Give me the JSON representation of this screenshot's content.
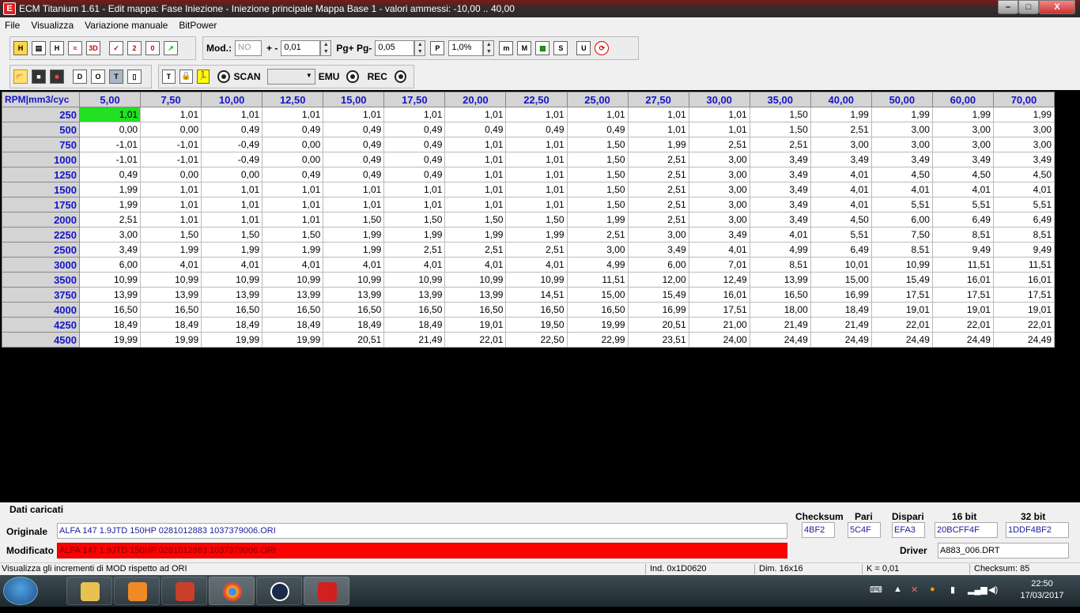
{
  "window": {
    "title": "ECM Titanium 1.61 - Edit mappa: Fase Iniezione - Iniezione principale Mappa Base 1 - valori ammessi: -10,00 .. 40,00",
    "app_icon": "ecm-titanium-icon",
    "buttons": {
      "minimize": "–",
      "maximize": "□",
      "close": "X"
    }
  },
  "menu": [
    "File",
    "Visualizza",
    "Variazione manuale",
    "BitPower"
  ],
  "toolbar1": {
    "icons_left": [
      "H",
      "▤",
      "H",
      "≈",
      "3D"
    ],
    "icons_mid": [
      "✓",
      "2",
      "0",
      "↗"
    ],
    "mod_label": "Mod.:",
    "mod_value": "NO",
    "plusminus_label": "+ -",
    "plusminus_value": "0,01",
    "pg_label": "Pg+ Pg-",
    "pg_value": "0,05",
    "p_icon": "P",
    "percent_value": "1,0%",
    "icons_right": [
      "m",
      "M",
      "▦",
      "S"
    ],
    "icons_far": [
      "U",
      "⟳"
    ]
  },
  "toolbar2": {
    "icons_file": [
      "📂",
      "💾",
      "💾"
    ],
    "icons_view": [
      "D",
      "O",
      "T",
      "▯"
    ],
    "icons_tools": [
      "T",
      "🔒",
      "🏃"
    ],
    "scan_label": "SCAN",
    "scan_value": "",
    "emu_label": "EMU",
    "rec_label": "REC"
  },
  "grid": {
    "corner": "RPM|mm3/cyc",
    "columns": [
      "5,00",
      "7,50",
      "10,00",
      "12,50",
      "15,00",
      "17,50",
      "20,00",
      "22,50",
      "25,00",
      "27,50",
      "30,00",
      "35,00",
      "40,00",
      "50,00",
      "60,00",
      "70,00"
    ],
    "rows": [
      {
        "rpm": "250",
        "values": [
          "1,01",
          "1,01",
          "1,01",
          "1,01",
          "1,01",
          "1,01",
          "1,01",
          "1,01",
          "1,01",
          "1,01",
          "1,01",
          "1,50",
          "1,99",
          "1,99",
          "1,99",
          "1,99"
        ]
      },
      {
        "rpm": "500",
        "values": [
          "0,00",
          "0,00",
          "0,49",
          "0,49",
          "0,49",
          "0,49",
          "0,49",
          "0,49",
          "0,49",
          "1,01",
          "1,01",
          "1,50",
          "2,51",
          "3,00",
          "3,00",
          "3,00"
        ]
      },
      {
        "rpm": "750",
        "values": [
          "-1,01",
          "-1,01",
          "-0,49",
          "0,00",
          "0,49",
          "0,49",
          "1,01",
          "1,01",
          "1,50",
          "1,99",
          "2,51",
          "2,51",
          "3,00",
          "3,00",
          "3,00",
          "3,00"
        ]
      },
      {
        "rpm": "1000",
        "values": [
          "-1,01",
          "-1,01",
          "-0,49",
          "0,00",
          "0,49",
          "0,49",
          "1,01",
          "1,01",
          "1,50",
          "2,51",
          "3,00",
          "3,49",
          "3,49",
          "3,49",
          "3,49",
          "3,49"
        ]
      },
      {
        "rpm": "1250",
        "values": [
          "0,49",
          "0,00",
          "0,00",
          "0,49",
          "0,49",
          "0,49",
          "1,01",
          "1,01",
          "1,50",
          "2,51",
          "3,00",
          "3,49",
          "4,01",
          "4,50",
          "4,50",
          "4,50"
        ]
      },
      {
        "rpm": "1500",
        "values": [
          "1,99",
          "1,01",
          "1,01",
          "1,01",
          "1,01",
          "1,01",
          "1,01",
          "1,01",
          "1,50",
          "2,51",
          "3,00",
          "3,49",
          "4,01",
          "4,01",
          "4,01",
          "4,01"
        ]
      },
      {
        "rpm": "1750",
        "values": [
          "1,99",
          "1,01",
          "1,01",
          "1,01",
          "1,01",
          "1,01",
          "1,01",
          "1,01",
          "1,50",
          "2,51",
          "3,00",
          "3,49",
          "4,01",
          "5,51",
          "5,51",
          "5,51"
        ]
      },
      {
        "rpm": "2000",
        "values": [
          "2,51",
          "1,01",
          "1,01",
          "1,01",
          "1,50",
          "1,50",
          "1,50",
          "1,50",
          "1,99",
          "2,51",
          "3,00",
          "3,49",
          "4,50",
          "6,00",
          "6,49",
          "6,49"
        ]
      },
      {
        "rpm": "2250",
        "values": [
          "3,00",
          "1,50",
          "1,50",
          "1,50",
          "1,99",
          "1,99",
          "1,99",
          "1,99",
          "2,51",
          "3,00",
          "3,49",
          "4,01",
          "5,51",
          "7,50",
          "8,51",
          "8,51"
        ]
      },
      {
        "rpm": "2500",
        "values": [
          "3,49",
          "1,99",
          "1,99",
          "1,99",
          "1,99",
          "2,51",
          "2,51",
          "2,51",
          "3,00",
          "3,49",
          "4,01",
          "4,99",
          "6,49",
          "8,51",
          "9,49",
          "9,49"
        ]
      },
      {
        "rpm": "3000",
        "values": [
          "6,00",
          "4,01",
          "4,01",
          "4,01",
          "4,01",
          "4,01",
          "4,01",
          "4,01",
          "4,99",
          "6,00",
          "7,01",
          "8,51",
          "10,01",
          "10,99",
          "11,51",
          "11,51"
        ]
      },
      {
        "rpm": "3500",
        "values": [
          "10,99",
          "10,99",
          "10,99",
          "10,99",
          "10,99",
          "10,99",
          "10,99",
          "10,99",
          "11,51",
          "12,00",
          "12,49",
          "13,99",
          "15,00",
          "15,49",
          "16,01",
          "16,01"
        ]
      },
      {
        "rpm": "3750",
        "values": [
          "13,99",
          "13,99",
          "13,99",
          "13,99",
          "13,99",
          "13,99",
          "13,99",
          "14,51",
          "15,00",
          "15,49",
          "16,01",
          "16,50",
          "16,99",
          "17,51",
          "17,51",
          "17,51"
        ]
      },
      {
        "rpm": "4000",
        "values": [
          "16,50",
          "16,50",
          "16,50",
          "16,50",
          "16,50",
          "16,50",
          "16,50",
          "16,50",
          "16,50",
          "16,99",
          "17,51",
          "18,00",
          "18,49",
          "19,01",
          "19,01",
          "19,01"
        ]
      },
      {
        "rpm": "4250",
        "values": [
          "18,49",
          "18,49",
          "18,49",
          "18,49",
          "18,49",
          "18,49",
          "19,01",
          "19,50",
          "19,99",
          "20,51",
          "21,00",
          "21,49",
          "21,49",
          "22,01",
          "22,01",
          "22,01"
        ]
      },
      {
        "rpm": "4500",
        "values": [
          "19,99",
          "19,99",
          "19,99",
          "19,99",
          "20,51",
          "21,49",
          "22,01",
          "22,50",
          "22,99",
          "23,51",
          "24,00",
          "24,49",
          "24,49",
          "24,49",
          "24,49",
          "24,49"
        ]
      }
    ],
    "selected_color": "#22e022"
  },
  "info": {
    "section_label": "Dati caricati",
    "originale_label": "Originale",
    "originale_value": "ALFA 147 1.9JTD 150HP 0281012883 1037379006.ORI",
    "modificato_label": "Modificato",
    "modificato_value": "ALFA 147 1.9JTD 150HP 0281012883 1037379006.ORI",
    "checksum_label": "Checksum",
    "checksum_value": "4BF2",
    "pari_label": "Pari",
    "pari_value": "5C4F",
    "dispari_label": "Dispari",
    "dispari_value": "EFA3",
    "bit16_label": "16 bit",
    "bit16_value": "20BCFF4F",
    "bit32_label": "32 bit",
    "bit32_value": "1DDF4BF2",
    "driver_label": "Driver",
    "driver_value": "A883_006.DRT"
  },
  "status": {
    "hint": "Visualizza gli incrementi di MOD rispetto ad ORI",
    "ind": "Ind. 0x1D0620",
    "dim": "Dim. 16x16",
    "k": "K = 0,01",
    "checksum": "Checksum: 85"
  },
  "taskbar": {
    "apps": [
      "explorer-icon",
      "media-player-icon",
      "tools-icon",
      "chrome-icon",
      "update-icon",
      "ecm-titanium-icon"
    ],
    "time": "22:50",
    "date": "17/03/2017"
  }
}
